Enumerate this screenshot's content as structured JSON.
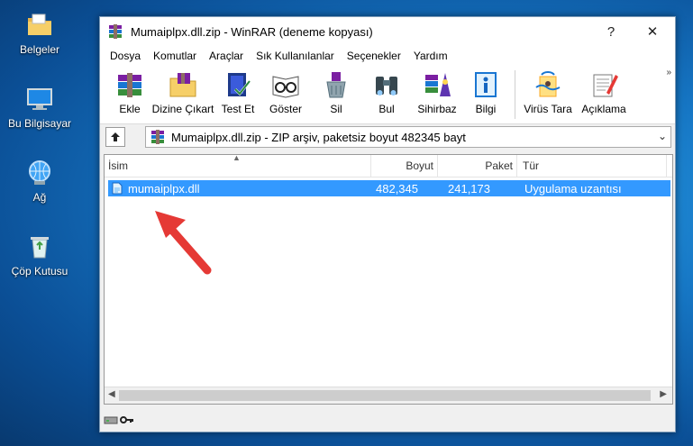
{
  "desktop": {
    "icons": [
      {
        "label": "Belgeler",
        "icon": "folder-icon"
      },
      {
        "label": "Bu Bilgisayar",
        "icon": "computer-icon"
      },
      {
        "label": "Ağ",
        "icon": "network-icon"
      },
      {
        "label": "Çöp Kutusu",
        "icon": "recycle-bin-icon"
      }
    ]
  },
  "window": {
    "title": "Mumaiplpx.dll.zip - WinRAR (deneme kopyası)",
    "help_glyph": "?",
    "close_glyph": "✕"
  },
  "menu": [
    "Dosya",
    "Komutlar",
    "Araçlar",
    "Sık Kullanılanlar",
    "Seçenekler",
    "Yardım"
  ],
  "toolbar": {
    "buttons": [
      "Ekle",
      "Dizine Çıkart",
      "Test Et",
      "Göster",
      "Sil",
      "Bul",
      "Sihirbaz",
      "Bilgi",
      "Virüs Tara",
      "Açıklama"
    ],
    "more_glyph": "»"
  },
  "address": {
    "text": "Mumaiplpx.dll.zip - ZIP arşiv, paketsiz boyut 482345 bayt",
    "dropdown_glyph": "⌄"
  },
  "columns": [
    "İsim",
    "Boyut",
    "Paket",
    "Tür"
  ],
  "files": [
    {
      "name": "mumaiplpx.dll",
      "size": "482,345",
      "packed": "241,173",
      "type": "Uygulama uzantısı"
    }
  ],
  "colors": {
    "selection": "#3399ff",
    "annotation_arrow": "#e53935"
  }
}
